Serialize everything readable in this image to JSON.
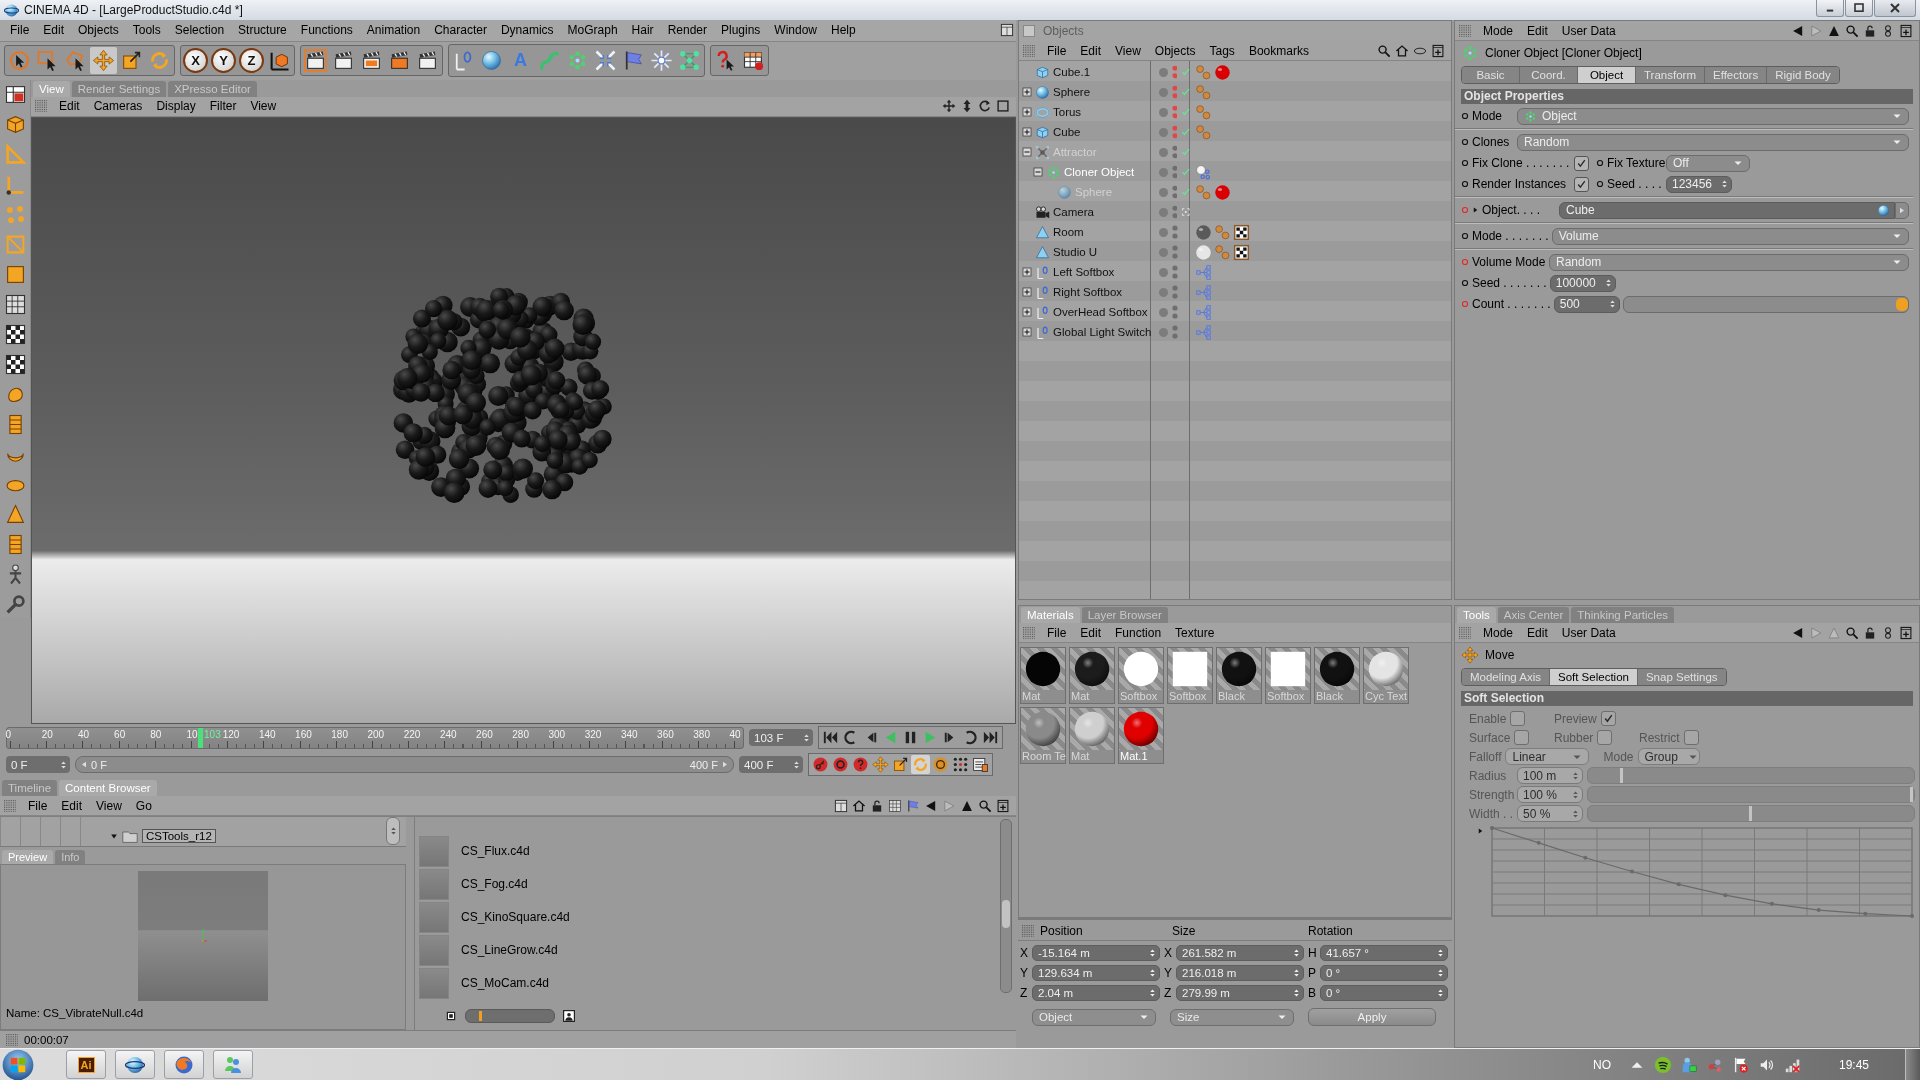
{
  "window": {
    "title": "CINEMA 4D - [LargeProductStudio.c4d *]"
  },
  "menu_bar": [
    "File",
    "Edit",
    "Objects",
    "Tools",
    "Selection",
    "Structure",
    "Functions",
    "Animation",
    "Character",
    "Dynamics",
    "MoGraph",
    "Hair",
    "Render",
    "Plugins",
    "Window",
    "Help"
  ],
  "toolbar": [
    [
      {
        "kind": "live-select",
        "selected": false
      },
      {
        "kind": "rect-select",
        "selected": false
      },
      {
        "kind": "lasso-select",
        "selected": false
      },
      {
        "kind": "move",
        "selected": true
      },
      {
        "kind": "scale",
        "selected": false
      },
      {
        "kind": "rotate",
        "selected": false
      }
    ],
    [
      {
        "kind": "axis-lock",
        "label": "X",
        "selected": false
      },
      {
        "kind": "axis-lock",
        "label": "Y",
        "selected": false
      },
      {
        "kind": "axis-lock",
        "label": "Z",
        "selected": false
      },
      {
        "kind": "coord-system",
        "selected": false
      }
    ],
    [
      {
        "kind": "clapper-frame",
        "selected": false
      },
      {
        "kind": "clapper",
        "selected": false
      },
      {
        "kind": "clapper-color",
        "selected": false
      },
      {
        "kind": "clapper-orange",
        "selected": false
      },
      {
        "kind": "clapper",
        "selected": false
      }
    ],
    [
      {
        "kind": "null",
        "selected": false
      },
      {
        "kind": "sphere",
        "selected": false
      },
      {
        "kind": "text",
        "label": "A",
        "selected": false
      },
      {
        "kind": "spline",
        "selected": false
      },
      {
        "kind": "cloner",
        "selected": false
      },
      {
        "kind": "deformer",
        "selected": false
      },
      {
        "kind": "flag",
        "selected": false
      },
      {
        "kind": "light",
        "selected": false
      },
      {
        "kind": "mograph",
        "selected": false
      }
    ],
    [
      {
        "kind": "help",
        "selected": false
      },
      {
        "kind": "table",
        "selected": false
      }
    ]
  ],
  "left_toolbar": [
    {
      "kind": "layout",
      "selected": false
    },
    {
      "kind": "cube",
      "selected": false
    },
    {
      "kind": "triangle",
      "selected": false
    },
    {
      "kind": "axis",
      "selected": false
    },
    {
      "kind": "points",
      "selected": false
    },
    {
      "kind": "edges",
      "selected": false
    },
    {
      "kind": "polygons",
      "selected": false
    },
    {
      "kind": "grid",
      "selected": false
    },
    {
      "kind": "checker",
      "selected": false
    },
    {
      "kind": "checker",
      "selected": false
    },
    {
      "kind": "blob",
      "selected": false
    },
    {
      "kind": "film",
      "selected": false
    },
    {
      "kind": "crescent",
      "selected": false
    },
    {
      "kind": "disc",
      "selected": false
    },
    {
      "kind": "cone",
      "selected": false
    },
    {
      "kind": "film",
      "selected": false
    },
    {
      "kind": "figure",
      "selected": false
    },
    {
      "kind": "wrench",
      "selected": false
    }
  ],
  "viewport": {
    "tabs": [
      {
        "label": "View",
        "selected": true
      },
      {
        "label": "Render Settings",
        "selected": false
      },
      {
        "label": "XPresso Editor",
        "selected": false
      }
    ],
    "menu": [
      "Edit",
      "Cameras",
      "Display",
      "Filter",
      "View"
    ]
  },
  "timeline": {
    "ruler_labels": [
      "0",
      "20",
      "40",
      "60",
      "80",
      "10",
      "120",
      "140",
      "160",
      "180",
      "200",
      "220",
      "240",
      "260",
      "280",
      "300",
      "320",
      "340",
      "360",
      "380",
      "40"
    ],
    "playhead": {
      "label": "103",
      "level": 0.2575
    },
    "current_frame": "103 F",
    "start_frame": "0 F",
    "range": {
      "start": "0 F",
      "end": "400 F"
    },
    "end_frame": "400 F",
    "transport": [
      {
        "kind": "skip-start"
      },
      {
        "kind": "prev-key"
      },
      {
        "kind": "step-back"
      },
      {
        "kind": "play-reverse"
      },
      {
        "kind": "pause"
      },
      {
        "kind": "play"
      },
      {
        "kind": "step-forward"
      },
      {
        "kind": "next-key"
      },
      {
        "kind": "skip-end"
      }
    ],
    "record": [
      {
        "kind": "record",
        "on": false
      },
      {
        "kind": "autokey",
        "on": false
      },
      {
        "kind": "key-help",
        "on": false
      },
      {
        "kind": "move",
        "on": false
      },
      {
        "kind": "scale",
        "on": false
      },
      {
        "kind": "rotate",
        "on": true
      },
      {
        "kind": "param",
        "on": false
      },
      {
        "kind": "points-grid",
        "on": false
      },
      {
        "kind": "timeline",
        "on": false
      }
    ]
  },
  "content_browser": {
    "tabs": [
      {
        "label": "Timeline",
        "selected": false
      },
      {
        "label": "Content Browser",
        "selected": true
      }
    ],
    "menu": [
      "File",
      "Edit",
      "View",
      "Go"
    ],
    "tree": [
      {
        "label": "CSTools_r12",
        "expanded": true,
        "selected": true
      }
    ],
    "preview_tabs": [
      {
        "label": "Preview",
        "selected": true
      },
      {
        "label": "Info",
        "selected": false
      }
    ],
    "preview_name": "Name: CS_VibrateNull.c4d",
    "files": [
      "CS_Flux.c4d",
      "CS_Fog.c4d",
      "CS_KinoSquare.c4d",
      "CS_LineGrow.c4d",
      "CS_MoCam.c4d"
    ],
    "thumb_size": {
      "level": 0.15
    }
  },
  "status_bar": {
    "time": "00:00:07"
  },
  "objects": {
    "title": "Objects",
    "menu": [
      "File",
      "Edit",
      "View",
      "Objects",
      "Tags",
      "Bookmarks"
    ],
    "tree": [
      {
        "name": "Cube.1",
        "kind": "cube",
        "selected": false,
        "greyed": false,
        "hidden": true,
        "check": true,
        "camera_active": false,
        "tags": [
          {
            "kind": "phong"
          },
          {
            "kind": "material",
            "color": "#d80000"
          }
        ]
      },
      {
        "name": "Sphere",
        "kind": "sphere",
        "expanded": false,
        "selected": false,
        "greyed": false,
        "hidden": true,
        "check": true,
        "camera_active": false,
        "tags": [
          {
            "kind": "phong"
          }
        ]
      },
      {
        "name": "Torus",
        "kind": "torus",
        "expanded": false,
        "selected": false,
        "greyed": false,
        "hidden": true,
        "check": true,
        "camera_active": false,
        "tags": [
          {
            "kind": "phong"
          }
        ]
      },
      {
        "name": "Cube",
        "kind": "cube",
        "expanded": false,
        "selected": false,
        "greyed": false,
        "hidden": true,
        "check": true,
        "camera_active": false,
        "tags": [
          {
            "kind": "phong"
          }
        ]
      },
      {
        "name": "Attractor",
        "kind": "attractor",
        "expanded": true,
        "selected": false,
        "greyed": true,
        "hidden": false,
        "check": true,
        "camera_active": false,
        "children": [
          {
            "name": "Cloner Object",
            "kind": "cloner",
            "expanded": true,
            "selected": true,
            "greyed": false,
            "hidden": false,
            "check": true,
            "camera_active": false,
            "tags": [
              {
                "kind": "cloner-tag"
              }
            ],
            "children": [
              {
                "name": "Sphere",
                "kind": "sphere",
                "selected": false,
                "greyed": true,
                "hidden": false,
                "check": true,
                "camera_active": false,
                "tags": [
                  {
                    "kind": "phong"
                  },
                  {
                    "kind": "material",
                    "color": "#d80000"
                  }
                ]
              }
            ]
          }
        ]
      },
      {
        "name": "Camera",
        "kind": "camera",
        "selected": false,
        "greyed": false,
        "hidden": false,
        "check": false,
        "camera_active": true
      },
      {
        "name": "Room",
        "kind": "polygon",
        "selected": false,
        "greyed": false,
        "hidden": false,
        "check": false,
        "camera_active": false,
        "tags": [
          {
            "kind": "material",
            "color": "#5a5a5a"
          },
          {
            "kind": "phong"
          },
          {
            "kind": "checker-tag"
          }
        ]
      },
      {
        "name": "Studio U",
        "kind": "polygon",
        "selected": false,
        "greyed": false,
        "hidden": false,
        "check": false,
        "camera_active": false,
        "tags": [
          {
            "kind": "material",
            "color": "#e6e6e6"
          },
          {
            "kind": "phong"
          },
          {
            "kind": "checker-tag"
          }
        ]
      },
      {
        "name": "Left Softbox",
        "kind": "null",
        "expanded": false,
        "selected": false,
        "greyed": false,
        "hidden": false,
        "check": false,
        "camera_active": false,
        "tags": [
          {
            "kind": "xpresso"
          }
        ]
      },
      {
        "name": "Right Softbox",
        "kind": "null",
        "expanded": false,
        "selected": false,
        "greyed": false,
        "hidden": false,
        "check": false,
        "camera_active": false,
        "tags": [
          {
            "kind": "xpresso"
          }
        ]
      },
      {
        "name": "OverHead Softbox",
        "kind": "null",
        "expanded": false,
        "selected": false,
        "greyed": false,
        "hidden": false,
        "check": false,
        "camera_active": false,
        "tags": [
          {
            "kind": "xpresso"
          }
        ]
      },
      {
        "name": "Global Light Switch",
        "kind": "null",
        "expanded": false,
        "selected": false,
        "greyed": false,
        "hidden": false,
        "check": false,
        "camera_active": false,
        "tags": [
          {
            "kind": "xpresso"
          }
        ]
      }
    ]
  },
  "attributes": {
    "menu": [
      "Mode",
      "Edit",
      "User Data"
    ],
    "title": "Cloner Object [Cloner Object]",
    "tabs": [
      {
        "label": "Basic",
        "selected": false
      },
      {
        "label": "Coord.",
        "selected": false
      },
      {
        "label": "Object",
        "selected": true
      },
      {
        "label": "Transform",
        "selected": false
      },
      {
        "label": "Effectors",
        "selected": false
      },
      {
        "label": "Rigid Body",
        "selected": false
      }
    ],
    "section": "Object Properties",
    "groups": [
      [
        {
          "kind": "dropdown",
          "label": "Mode",
          "value": "Object",
          "value_icon": {
            "kind": "cloner"
          },
          "animated": false
        }
      ],
      [
        {
          "kind": "dropdown",
          "label": "Clones",
          "value": "Random",
          "animated": false
        },
        {
          "kind": "pair",
          "left": {
            "kind": "checkbox",
            "label": "Fix Clone . . . . . . .",
            "checked": true,
            "animated": false
          },
          "right": {
            "kind": "dropdown",
            "label": "Fix Texture",
            "value": "Off",
            "animated": false
          }
        },
        {
          "kind": "pair",
          "left": {
            "kind": "checkbox",
            "label": "Render Instances",
            "checked": true,
            "animated": false
          },
          "right": {
            "kind": "spinner",
            "label": "Seed . . . .",
            "value": "123456",
            "animated": false
          }
        }
      ],
      [
        {
          "kind": "link",
          "label": "Object. . . .",
          "value": "Cube",
          "value_icon": {
            "kind": "cube"
          },
          "animated": true
        }
      ],
      [
        {
          "kind": "dropdown",
          "label": "Mode . . . . . . .",
          "value": "Volume",
          "animated": false
        }
      ],
      [
        {
          "kind": "dropdown",
          "label": "Volume Mode",
          "value": "Random",
          "animated": true
        },
        {
          "kind": "spinner",
          "label": "Seed . . . . . . .",
          "value": "100000",
          "animated": false
        },
        {
          "kind": "slider",
          "label": "Count . . . . . . .",
          "value": "500",
          "level": 1,
          "animated": true
        }
      ]
    ]
  },
  "materials": {
    "tabs": [
      {
        "label": "Materials",
        "selected": true
      },
      {
        "label": "Layer Browser",
        "selected": false
      }
    ],
    "menu": [
      "File",
      "Edit",
      "Function",
      "Texture"
    ],
    "items": [
      {
        "name": "Mat",
        "kind": "flat",
        "color": "#050505",
        "selected": false
      },
      {
        "name": "Mat",
        "kind": "sphere",
        "color": "#1c1c1c",
        "selected": false
      },
      {
        "name": "Softbox",
        "kind": "flat",
        "color": "#ffffff",
        "selected": false
      },
      {
        "name": "Softbox",
        "kind": "square",
        "color": "#ffffff",
        "selected": false
      },
      {
        "name": "Black",
        "kind": "sphere",
        "color": "#111111",
        "selected": false
      },
      {
        "name": "Softbox",
        "kind": "square",
        "color": "#ffffff",
        "selected": false
      },
      {
        "name": "Black",
        "kind": "sphere",
        "color": "#111111",
        "selected": false
      },
      {
        "name": "Cyc Text",
        "kind": "sphere",
        "color": "#e4e4e4",
        "selected": false
      },
      {
        "name": "Room Te",
        "kind": "sphere",
        "color": "#8a8a8a",
        "selected": false
      },
      {
        "name": "Mat",
        "kind": "sphere",
        "color": "#cfcfcf",
        "selected": false
      },
      {
        "name": "Mat.1",
        "kind": "sphere",
        "color": "#e00000",
        "selected": true
      }
    ]
  },
  "coordinates": {
    "headers": [
      "Position",
      "Size",
      "Rotation"
    ],
    "rows": [
      [
        {
          "axis": "X",
          "value": "-15.164 m"
        },
        {
          "axis": "X",
          "value": "261.582 m"
        },
        {
          "axis": "H",
          "value": "41.657 °"
        }
      ],
      [
        {
          "axis": "Y",
          "value": "129.634 m"
        },
        {
          "axis": "Y",
          "value": "216.018 m"
        },
        {
          "axis": "P",
          "value": "0 °"
        }
      ],
      [
        {
          "axis": "Z",
          "value": "2.04 m"
        },
        {
          "axis": "Z",
          "value": "279.99 m"
        },
        {
          "axis": "B",
          "value": "0 °"
        }
      ]
    ],
    "dropdowns": [
      "Object",
      "Size"
    ],
    "apply": "Apply"
  },
  "tools_panel": {
    "tabs": [
      {
        "label": "Tools",
        "selected": true
      },
      {
        "label": "Axis Center",
        "selected": false
      },
      {
        "label": "Thinking Particles",
        "selected": false
      }
    ],
    "menu": [
      "Mode",
      "Edit",
      "User Data"
    ],
    "tool": "Move",
    "subtabs": [
      {
        "label": "Modeling Axis",
        "selected": false
      },
      {
        "label": "Soft Selection",
        "selected": true
      },
      {
        "label": "Snap Settings",
        "selected": false
      }
    ],
    "section": "Soft Selection",
    "disabled": true,
    "checkbox_rows": [
      [
        {
          "label": "Enable",
          "checked": false
        },
        {
          "label": "Preview",
          "checked": true
        }
      ],
      [
        {
          "label": "Surface",
          "checked": false
        },
        {
          "label": "Rubber",
          "checked": false
        },
        {
          "label": "Restrict",
          "checked": false
        }
      ]
    ],
    "dropdowns": [
      {
        "label": "Falloff",
        "value": "Linear"
      },
      {
        "label": "Mode",
        "value": "Group"
      }
    ],
    "sliders": [
      {
        "label": "Radius",
        "value": "100 m",
        "level": 0.1
      },
      {
        "label": "Strength",
        "value": "100 %",
        "level": 1
      },
      {
        "label": "Width . .",
        "value": "50 %",
        "level": 0.5
      }
    ]
  },
  "taskbar": {
    "apps": [
      {
        "kind": "illustrator",
        "label": "Ai"
      },
      {
        "kind": "cinema4d"
      },
      {
        "kind": "firefox"
      },
      {
        "kind": "messenger"
      }
    ],
    "language": "NO",
    "tray": [
      {
        "kind": "up-arrow"
      },
      {
        "kind": "spotify"
      },
      {
        "kind": "people"
      },
      {
        "kind": "network-tool"
      },
      {
        "kind": "flag-x"
      },
      {
        "kind": "speaker"
      },
      {
        "kind": "signal-x"
      }
    ],
    "clock": "19:45"
  }
}
